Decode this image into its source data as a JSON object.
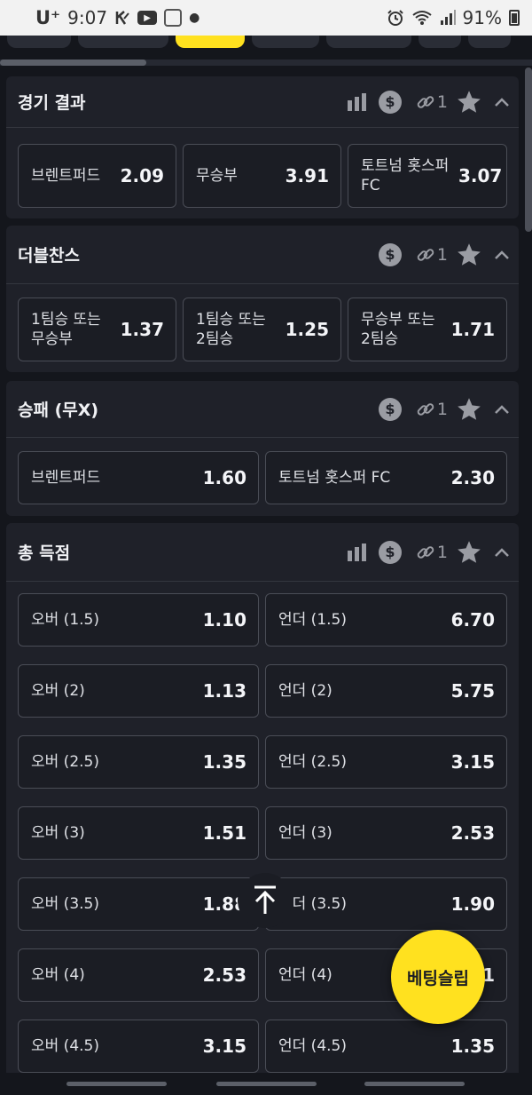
{
  "status_bar": {
    "carrier": "U⁺",
    "time": "9:07",
    "battery": "91%"
  },
  "markets": [
    {
      "title": "경기 결과",
      "link_count": "1",
      "options": [
        {
          "label": "브렌트퍼드",
          "odds": "2.09"
        },
        {
          "label": "무승부",
          "odds": "3.91"
        },
        {
          "label": "토트넘 홋스퍼 FC",
          "odds": "3.07"
        }
      ]
    },
    {
      "title": "더블찬스",
      "link_count": "1",
      "options": [
        {
          "label": "1팀승 또는 무승부",
          "odds": "1.37"
        },
        {
          "label": "1팀승 또는 2팀승",
          "odds": "1.25"
        },
        {
          "label": "무승부 또는 2팀승",
          "odds": "1.71"
        }
      ]
    },
    {
      "title": "승패 (무X)",
      "link_count": "1",
      "options": [
        {
          "label": "브렌트퍼드",
          "odds": "1.60"
        },
        {
          "label": "토트넘 홋스퍼 FC",
          "odds": "2.30"
        }
      ]
    },
    {
      "title": "총 득점",
      "link_count": "1",
      "options": [
        {
          "label": "오버 (1.5)",
          "odds": "1.10"
        },
        {
          "label": "언더 (1.5)",
          "odds": "6.70"
        },
        {
          "label": "오버 (2)",
          "odds": "1.13"
        },
        {
          "label": "언더 (2)",
          "odds": "5.75"
        },
        {
          "label": "오버 (2.5)",
          "odds": "1.35"
        },
        {
          "label": "언더 (2.5)",
          "odds": "3.15"
        },
        {
          "label": "오버 (3)",
          "odds": "1.51"
        },
        {
          "label": "언더 (3)",
          "odds": "2.53"
        },
        {
          "label": "오버 (3.5)",
          "odds": "1.88"
        },
        {
          "label": "언더 (3.5)",
          "odds": "1.90"
        },
        {
          "label": "오버 (4)",
          "odds": "2.53"
        },
        {
          "label": "언더 (4)",
          "odds": "1.51"
        },
        {
          "label": "오버 (4.5)",
          "odds": "3.15"
        },
        {
          "label": "언더 (4.5)",
          "odds": "1.35"
        }
      ]
    }
  ],
  "betslip_label": "베팅슬립",
  "colors": {
    "background": "#14161c",
    "card": "#1f2129",
    "accent": "#ffe11f"
  }
}
